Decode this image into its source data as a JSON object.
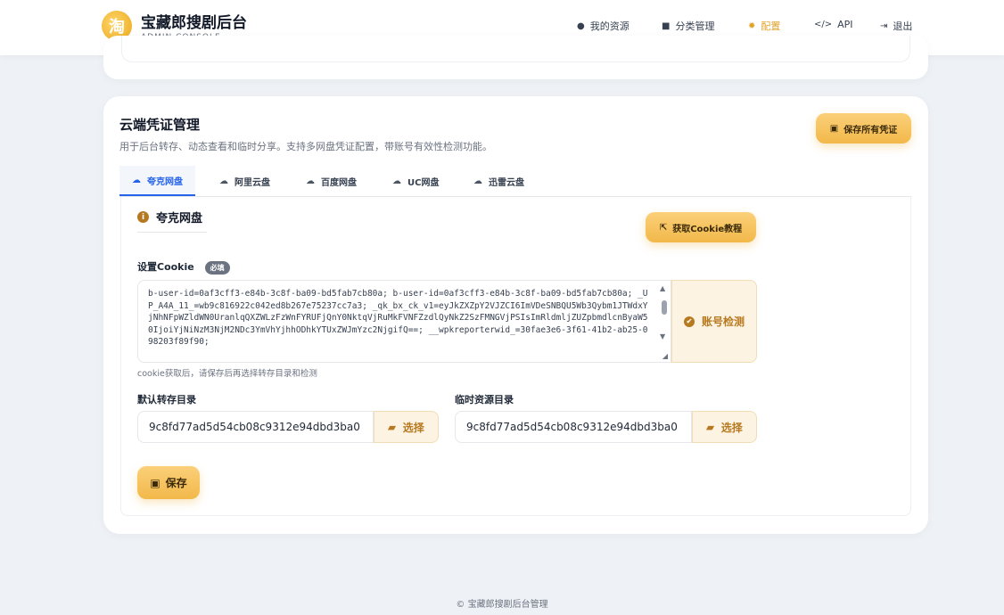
{
  "brand": {
    "logo_glyph": "淘",
    "title": "宝藏郎搜剧后台",
    "subtitle": "ADMIN CONSOLE"
  },
  "nav": {
    "items": [
      {
        "icon": "fire-icon",
        "glyph": "●",
        "label": "我的资源"
      },
      {
        "icon": "folder-icon",
        "glyph": "■",
        "label": "分类管理"
      },
      {
        "icon": "gear-icon",
        "glyph": "✹",
        "label": "配置"
      },
      {
        "icon": "code-icon",
        "glyph": "</>",
        "label": "API"
      },
      {
        "icon": "logout-icon",
        "glyph": "⇥",
        "label": "退出"
      }
    ],
    "active": "配置"
  },
  "section": {
    "title": "云端凭证管理",
    "description": "用于后台转存、动态查看和临时分享。支持多网盘凭证配置，带账号有效性检测功能。",
    "save_all_label": "保存所有凭证"
  },
  "tabs": [
    {
      "label": "夸克网盘",
      "active": true
    },
    {
      "label": "阿里云盘",
      "active": false
    },
    {
      "label": "百度网盘",
      "active": false
    },
    {
      "label": "UC网盘",
      "active": false
    },
    {
      "label": "迅雷云盘",
      "active": false
    }
  ],
  "panel": {
    "title": "夸克网盘",
    "tutorial_label": "获取Cookie教程",
    "cookie_label": "设置Cookie",
    "required_badge": "必填",
    "cookie_value": "b-user-id=0af3cff3-e84b-3c8f-ba09-bd5fab7cb80a; b-user-id=0af3cff3-e84b-3c8f-ba09-bd5fab7cb80a; _UP_A4A_11_=wb9c816922c042ed8b267e75237cc7a3; _qk_bx_ck_v1=eyJkZXZpY2VJZCI6ImVDeSNBQU5Wb3Qybm1JTWdxYjNhNFpWZldWN0UranlqQXZWLzFzWnFYRUFjQnY0NktqVjRuMkFVNFZzdlQyNkZ2SzFMNGVjPSIsImRldmljZUZpbmdlcnByaW50IjoiYjNiNzM3NjM2NDc3YmVhYjhhODhkYTUxZWJmYzc2NjgifQ==; __wpkreporterwid_=30fae3e6-3f61-41b2-ab25-098203f89f90;",
    "check_label": "账号检测",
    "cookie_hint": "cookie获取后，请保存后再选择转存目录和检测",
    "default_dir_label": "默认转存目录",
    "default_dir_value": "9c8fd77ad5d54cb08c9312e94dbd3ba0",
    "temp_dir_label": "临时资源目录",
    "temp_dir_value": "9c8fd77ad5d54cb08c9312e94dbd3ba0",
    "choose_label": "选择",
    "save_label": "保存"
  },
  "footer": {
    "text": "© 宝藏郎搜剧后台管理"
  },
  "colors": {
    "accent": "#e0a22a",
    "tab_active": "#2563eb",
    "gold_button": "#f2b84a"
  }
}
